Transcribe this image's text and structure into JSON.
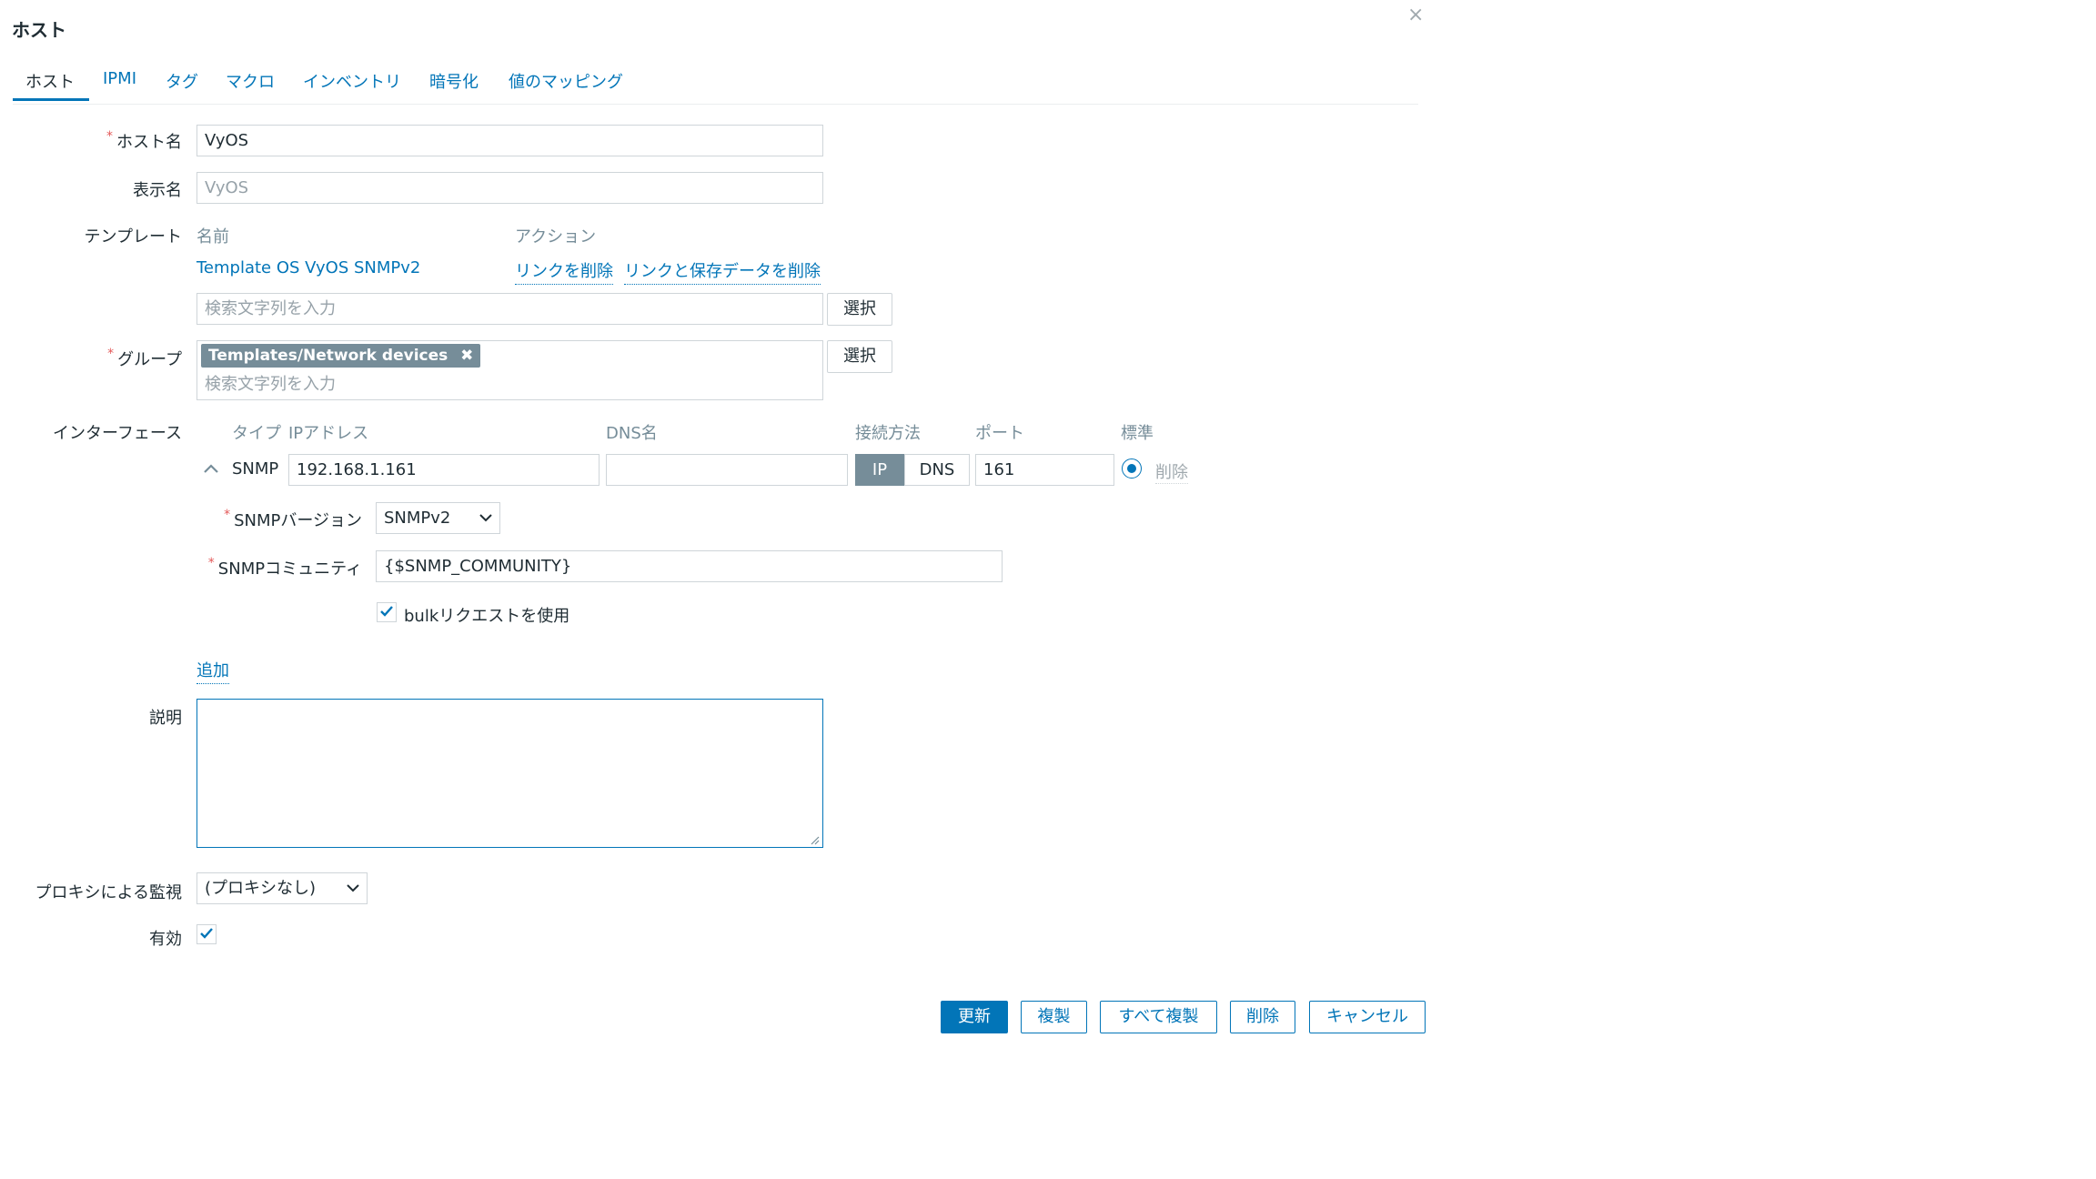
{
  "dialog": {
    "title": "ホスト",
    "close_symbol": "×"
  },
  "tabs": [
    {
      "label": "ホスト"
    },
    {
      "label": "IPMI"
    },
    {
      "label": "タグ"
    },
    {
      "label": "マクロ"
    },
    {
      "label": "インベントリ"
    },
    {
      "label": "暗号化"
    },
    {
      "label": "値のマッピング"
    }
  ],
  "form": {
    "hostname": {
      "label": "ホスト名",
      "value": "VyOS"
    },
    "visible_name": {
      "label": "表示名",
      "placeholder": "VyOS"
    },
    "templates": {
      "label": "テンプレート",
      "col_name": "名前",
      "col_action": "アクション",
      "linked": {
        "name": "Template OS VyOS SNMPv2",
        "unlink": "リンクを削除",
        "unlink_clear": "リンクと保存データを削除"
      },
      "search_placeholder": "検索文字列を入力",
      "select_label": "選択"
    },
    "groups": {
      "label": "グループ",
      "tag": "Templates/Network devices",
      "tag_remove": "✖",
      "search_placeholder": "検索文字列を入力",
      "select_label": "選択"
    },
    "interfaces": {
      "label": "インターフェース",
      "headers": {
        "type": "タイプ",
        "ip": "IPアドレス",
        "dns": "DNS名",
        "connect": "接続方法",
        "port": "ポート",
        "default": "標準"
      },
      "row": {
        "type": "SNMP",
        "ip": "192.168.1.161",
        "dns": "",
        "connect_ip": "IP",
        "connect_dns": "DNS",
        "port": "161",
        "remove": "削除"
      },
      "snmp_version": {
        "label": "SNMPバージョン",
        "value": "SNMPv2"
      },
      "snmp_community": {
        "label": "SNMPコミュニティ",
        "value": "{$SNMP_COMMUNITY}"
      },
      "bulk": {
        "label": "bulkリクエストを使用",
        "checked": true
      },
      "add_label": "追加"
    },
    "description": {
      "label": "説明",
      "value": ""
    },
    "proxy": {
      "label": "プロキシによる監視",
      "value": "(プロキシなし)"
    },
    "enabled": {
      "label": "有効",
      "checked": true
    }
  },
  "buttons": {
    "update": "更新",
    "clone": "複製",
    "full_clone": "すべて複製",
    "delete": "削除",
    "cancel": "キャンセル"
  },
  "colors": {
    "accent": "#0275b8",
    "required": "#e45959",
    "tag_bg": "#768d99"
  }
}
